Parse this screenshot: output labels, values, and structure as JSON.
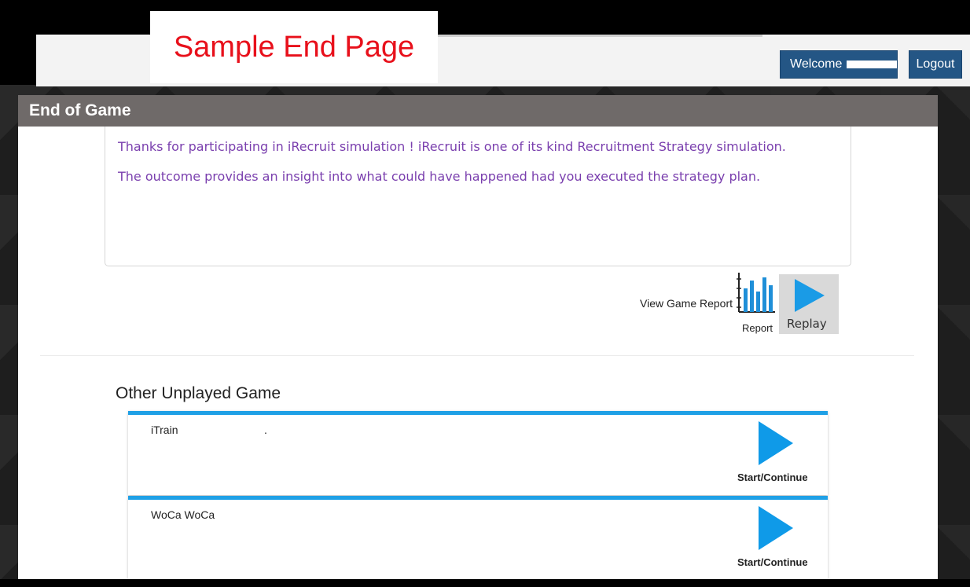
{
  "annotation": {
    "label": "Sample End Page"
  },
  "header": {
    "welcome_label": "Welcome",
    "logout_label": "Logout"
  },
  "panel": {
    "title": "End of Game",
    "message_line1": "Thanks for participating in iRecruit simulation ! iRecruit is one of its kind Recruitment Strategy simulation.",
    "message_line2": "The outcome provides an insight into what could have happened had you executed the strategy plan.",
    "view_report_label": "View Game Report",
    "report_icon_label": "Report",
    "replay_label": "Replay"
  },
  "other_games": {
    "title": "Other Unplayed Game",
    "items": [
      {
        "name": "iTrain",
        "suffix": ".",
        "action_label": "Start/Continue"
      },
      {
        "name": "WoCa WoCa",
        "suffix": "",
        "action_label": "Start/Continue"
      }
    ]
  },
  "colors": {
    "header_bar": "#6f6a69",
    "accent_blue": "#1fa0e6",
    "button_blue": "#245685",
    "message_purple": "#7a3fae",
    "annotation_red": "#e8101b"
  },
  "icons": {
    "report": "bar-chart-icon",
    "replay": "play-icon",
    "start": "play-icon"
  }
}
